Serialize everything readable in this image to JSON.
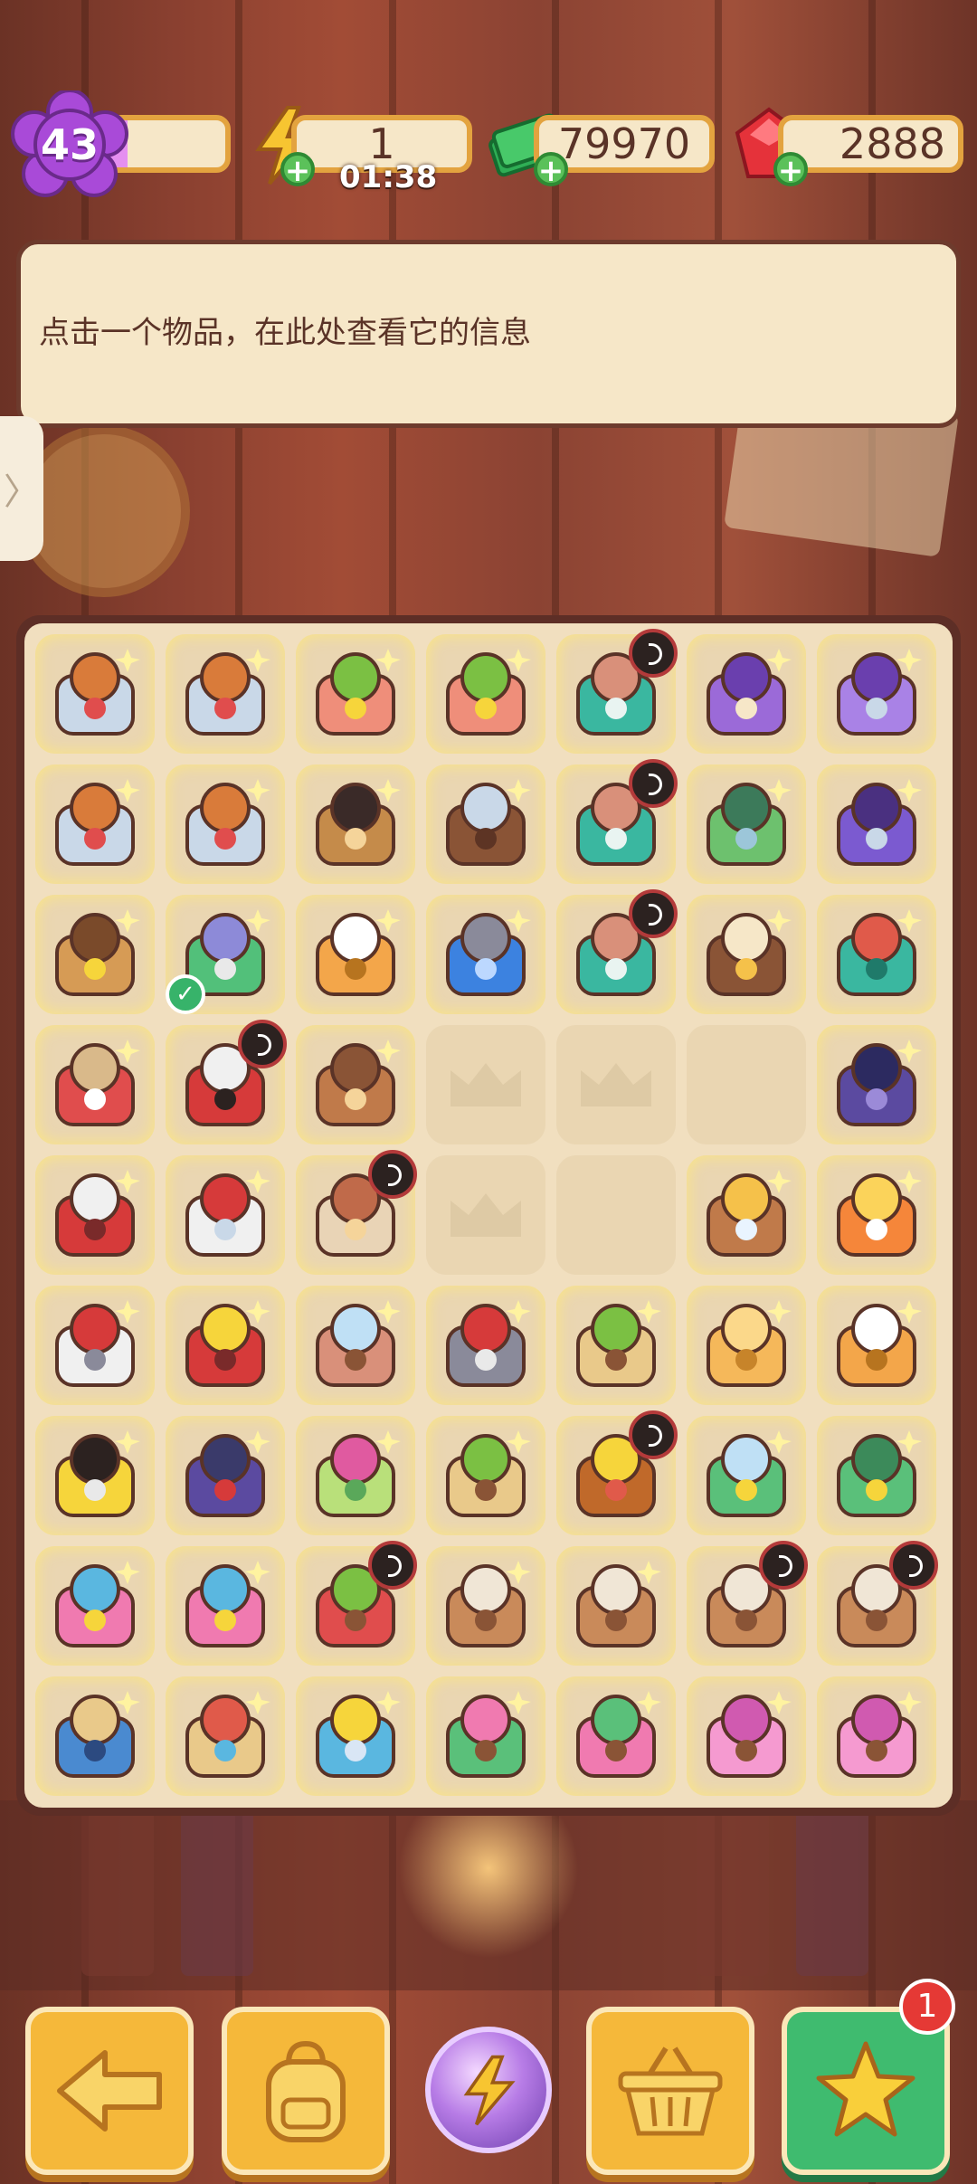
{
  "hud": {
    "level": "43",
    "level_progress": 0.22,
    "energy": "1",
    "energy_timer": "01:38",
    "cash": "79970",
    "gems": "2888"
  },
  "info_panel": {
    "text": "点击一个物品，在此处查看它的信息"
  },
  "side_tab": {
    "glyph": "〉"
  },
  "board": {
    "columns": 7,
    "rows": [
      [
        "fountain-statue",
        "fountain-statue",
        "potted-yellow-flowers",
        "potted-yellow-flowers",
        "medkit-bottles",
        "purple-car",
        "purple-helicopter"
      ],
      [
        "fountain-statue",
        "fountain-statue",
        "german-shepherd-dog",
        "photo-frames",
        "medkit-bottles",
        "green-brush",
        "purple-jeep"
      ],
      [
        "empty-flower-pot",
        "lipstick-brush",
        "hourglass-tile",
        "blue-gem-rock",
        "medkit-bottles",
        "paper-scraps",
        "first-aid-kit"
      ],
      [
        "red-toolbox-open",
        "red-toolbox",
        "clay-pot",
        "empty",
        "empty",
        "empty",
        "bicycle-wheels"
      ],
      [
        "red-machine",
        "red-machine-white",
        "striped-vase",
        "empty",
        "empty",
        "small-vase",
        "energy-coin"
      ],
      [
        "white-red-machine",
        "red-kettle",
        "glass-vase",
        "hand-rake",
        "plant-crate",
        "bread-slices",
        "hourglass-tile"
      ],
      [
        "traffic-barrier",
        "folding-bike",
        "soap-bottle",
        "plant-crate",
        "treasure-chest",
        "green-spa-fountain",
        "green-spa-machine"
      ],
      [
        "flower-basket",
        "flower-basket",
        "red-flower-planter",
        "pottery-shelf",
        "pottery-shelf",
        "pottery-shelf",
        "pottery-shelf"
      ],
      [
        "blue-safe-box",
        "cash-register-box",
        "map-table",
        "green-pink-tree",
        "pink-tree",
        "pink-blossom-tree",
        "pink-blossom-tree"
      ]
    ],
    "timer_badges": [
      [
        0,
        4
      ],
      [
        1,
        4
      ],
      [
        2,
        4
      ],
      [
        3,
        1
      ],
      [
        4,
        2
      ],
      [
        6,
        4
      ],
      [
        7,
        2
      ],
      [
        7,
        5
      ],
      [
        7,
        6
      ]
    ],
    "check_badges": [
      [
        2,
        1
      ]
    ],
    "crown_placeholders": [
      [
        3,
        3
      ],
      [
        3,
        4
      ],
      [
        4,
        3
      ]
    ]
  },
  "bottom_bar": {
    "buttons": [
      "back-button",
      "backpack-button",
      "energy-orb-button",
      "shop-basket-button",
      "star-tasks-button"
    ],
    "notification_count": "1"
  },
  "colors": {
    "panel_bg": "#f6e7c8",
    "panel_border": "#e3a33f",
    "board_frame": "#5d2e26",
    "button_orange": "#f5b83a",
    "button_green": "#3fbb6f",
    "notification_red": "#e53935"
  }
}
